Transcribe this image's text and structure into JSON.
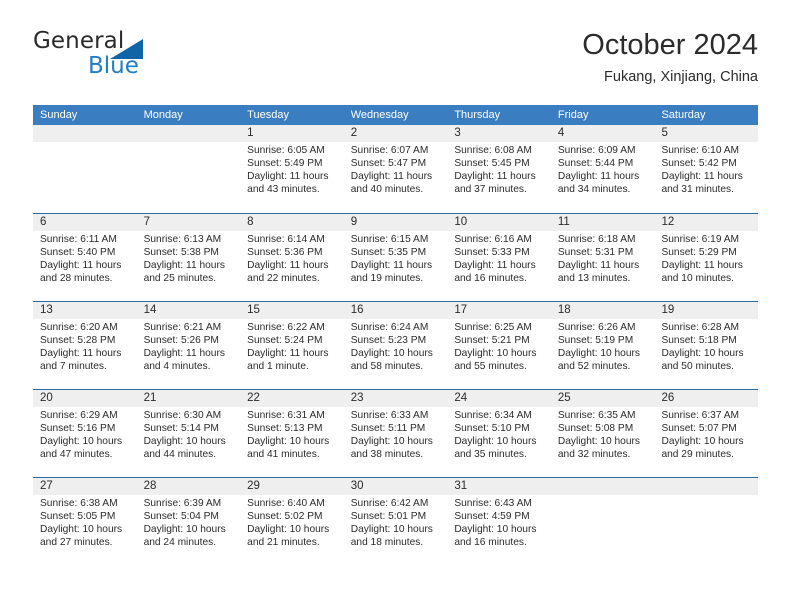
{
  "brand": {
    "name_part1": "General",
    "name_part2": "Blue",
    "logo_icon": "triangle-flag-icon",
    "accent_color": "#1f7ec4",
    "triangle_color": "#1065a8"
  },
  "header": {
    "title": "October 2024",
    "subtitle": "Fukang, Xinjiang, China"
  },
  "calendar": {
    "header_bg": "#3a7dc0",
    "row_border_color": "#2e6da4",
    "daynum_band_color": "#efefef",
    "weekday_headers": [
      "Sunday",
      "Monday",
      "Tuesday",
      "Wednesday",
      "Thursday",
      "Friday",
      "Saturday"
    ],
    "weeks": [
      [
        {
          "day": "",
          "lines": []
        },
        {
          "day": "",
          "lines": []
        },
        {
          "day": "1",
          "lines": [
            "Sunrise: 6:05 AM",
            "Sunset: 5:49 PM",
            "Daylight: 11 hours",
            "and 43 minutes."
          ]
        },
        {
          "day": "2",
          "lines": [
            "Sunrise: 6:07 AM",
            "Sunset: 5:47 PM",
            "Daylight: 11 hours",
            "and 40 minutes."
          ]
        },
        {
          "day": "3",
          "lines": [
            "Sunrise: 6:08 AM",
            "Sunset: 5:45 PM",
            "Daylight: 11 hours",
            "and 37 minutes."
          ]
        },
        {
          "day": "4",
          "lines": [
            "Sunrise: 6:09 AM",
            "Sunset: 5:44 PM",
            "Daylight: 11 hours",
            "and 34 minutes."
          ]
        },
        {
          "day": "5",
          "lines": [
            "Sunrise: 6:10 AM",
            "Sunset: 5:42 PM",
            "Daylight: 11 hours",
            "and 31 minutes."
          ]
        }
      ],
      [
        {
          "day": "6",
          "lines": [
            "Sunrise: 6:11 AM",
            "Sunset: 5:40 PM",
            "Daylight: 11 hours",
            "and 28 minutes."
          ]
        },
        {
          "day": "7",
          "lines": [
            "Sunrise: 6:13 AM",
            "Sunset: 5:38 PM",
            "Daylight: 11 hours",
            "and 25 minutes."
          ]
        },
        {
          "day": "8",
          "lines": [
            "Sunrise: 6:14 AM",
            "Sunset: 5:36 PM",
            "Daylight: 11 hours",
            "and 22 minutes."
          ]
        },
        {
          "day": "9",
          "lines": [
            "Sunrise: 6:15 AM",
            "Sunset: 5:35 PM",
            "Daylight: 11 hours",
            "and 19 minutes."
          ]
        },
        {
          "day": "10",
          "lines": [
            "Sunrise: 6:16 AM",
            "Sunset: 5:33 PM",
            "Daylight: 11 hours",
            "and 16 minutes."
          ]
        },
        {
          "day": "11",
          "lines": [
            "Sunrise: 6:18 AM",
            "Sunset: 5:31 PM",
            "Daylight: 11 hours",
            "and 13 minutes."
          ]
        },
        {
          "day": "12",
          "lines": [
            "Sunrise: 6:19 AM",
            "Sunset: 5:29 PM",
            "Daylight: 11 hours",
            "and 10 minutes."
          ]
        }
      ],
      [
        {
          "day": "13",
          "lines": [
            "Sunrise: 6:20 AM",
            "Sunset: 5:28 PM",
            "Daylight: 11 hours",
            "and 7 minutes."
          ]
        },
        {
          "day": "14",
          "lines": [
            "Sunrise: 6:21 AM",
            "Sunset: 5:26 PM",
            "Daylight: 11 hours",
            "and 4 minutes."
          ]
        },
        {
          "day": "15",
          "lines": [
            "Sunrise: 6:22 AM",
            "Sunset: 5:24 PM",
            "Daylight: 11 hours",
            "and 1 minute."
          ]
        },
        {
          "day": "16",
          "lines": [
            "Sunrise: 6:24 AM",
            "Sunset: 5:23 PM",
            "Daylight: 10 hours",
            "and 58 minutes."
          ]
        },
        {
          "day": "17",
          "lines": [
            "Sunrise: 6:25 AM",
            "Sunset: 5:21 PM",
            "Daylight: 10 hours",
            "and 55 minutes."
          ]
        },
        {
          "day": "18",
          "lines": [
            "Sunrise: 6:26 AM",
            "Sunset: 5:19 PM",
            "Daylight: 10 hours",
            "and 52 minutes."
          ]
        },
        {
          "day": "19",
          "lines": [
            "Sunrise: 6:28 AM",
            "Sunset: 5:18 PM",
            "Daylight: 10 hours",
            "and 50 minutes."
          ]
        }
      ],
      [
        {
          "day": "20",
          "lines": [
            "Sunrise: 6:29 AM",
            "Sunset: 5:16 PM",
            "Daylight: 10 hours",
            "and 47 minutes."
          ]
        },
        {
          "day": "21",
          "lines": [
            "Sunrise: 6:30 AM",
            "Sunset: 5:14 PM",
            "Daylight: 10 hours",
            "and 44 minutes."
          ]
        },
        {
          "day": "22",
          "lines": [
            "Sunrise: 6:31 AM",
            "Sunset: 5:13 PM",
            "Daylight: 10 hours",
            "and 41 minutes."
          ]
        },
        {
          "day": "23",
          "lines": [
            "Sunrise: 6:33 AM",
            "Sunset: 5:11 PM",
            "Daylight: 10 hours",
            "and 38 minutes."
          ]
        },
        {
          "day": "24",
          "lines": [
            "Sunrise: 6:34 AM",
            "Sunset: 5:10 PM",
            "Daylight: 10 hours",
            "and 35 minutes."
          ]
        },
        {
          "day": "25",
          "lines": [
            "Sunrise: 6:35 AM",
            "Sunset: 5:08 PM",
            "Daylight: 10 hours",
            "and 32 minutes."
          ]
        },
        {
          "day": "26",
          "lines": [
            "Sunrise: 6:37 AM",
            "Sunset: 5:07 PM",
            "Daylight: 10 hours",
            "and 29 minutes."
          ]
        }
      ],
      [
        {
          "day": "27",
          "lines": [
            "Sunrise: 6:38 AM",
            "Sunset: 5:05 PM",
            "Daylight: 10 hours",
            "and 27 minutes."
          ]
        },
        {
          "day": "28",
          "lines": [
            "Sunrise: 6:39 AM",
            "Sunset: 5:04 PM",
            "Daylight: 10 hours",
            "and 24 minutes."
          ]
        },
        {
          "day": "29",
          "lines": [
            "Sunrise: 6:40 AM",
            "Sunset: 5:02 PM",
            "Daylight: 10 hours",
            "and 21 minutes."
          ]
        },
        {
          "day": "30",
          "lines": [
            "Sunrise: 6:42 AM",
            "Sunset: 5:01 PM",
            "Daylight: 10 hours",
            "and 18 minutes."
          ]
        },
        {
          "day": "31",
          "lines": [
            "Sunrise: 6:43 AM",
            "Sunset: 4:59 PM",
            "Daylight: 10 hours",
            "and 16 minutes."
          ]
        },
        {
          "day": "",
          "lines": []
        },
        {
          "day": "",
          "lines": []
        }
      ]
    ]
  }
}
